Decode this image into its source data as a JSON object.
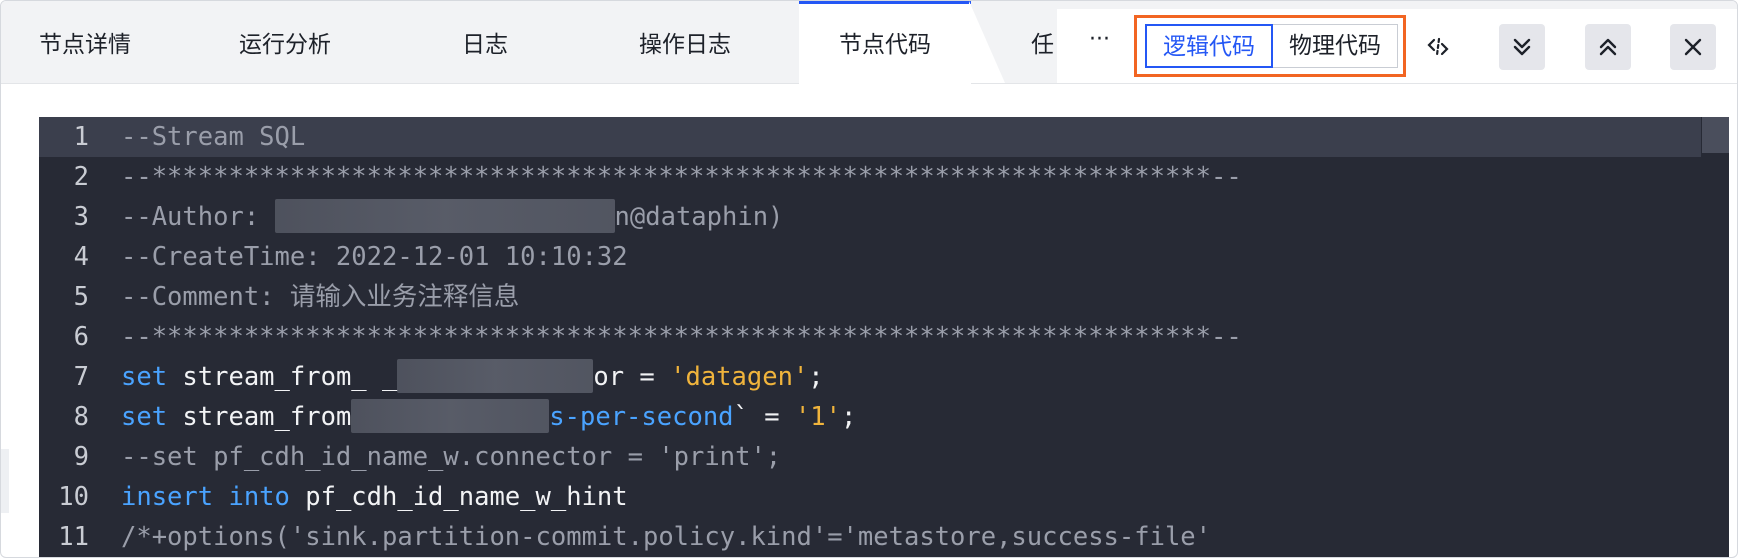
{
  "tabs": [
    {
      "label": "节点详情"
    },
    {
      "label": "运行分析"
    },
    {
      "label": "日志"
    },
    {
      "label": "操作日志"
    },
    {
      "label": "节点代码"
    },
    {
      "label": "任"
    }
  ],
  "toolbar": {
    "more_label": "···",
    "logical_code_label": "逻辑代码",
    "physical_code_label": "物理代码",
    "icons": [
      "format-code-icon",
      "collapse-down-icon",
      "expand-up-icon",
      "close-icon"
    ]
  },
  "colors": {
    "accent": "#2457f5",
    "highlight_outline": "#f26522",
    "editor_bg": "#272a35",
    "keyword": "#4aa3ff",
    "string": "#f0b43c",
    "comment": "#9a9eaa"
  },
  "editor": {
    "line_numbers": [
      "1",
      "2",
      "3",
      "4",
      "5",
      "6",
      "7",
      "8",
      "9",
      "10",
      "11"
    ],
    "current_line": "1",
    "lines": {
      "l1": "--Stream SQL",
      "l2": "--*********************************************************************--",
      "l3_prefix": "--Author: ",
      "l3_suffix": "n@dataphin)",
      "l4": "--CreateTime: 2022-12-01 10:10:32",
      "l5": "--Comment: 请输入业务注释信息",
      "l6": "--*********************************************************************--",
      "l7_kw": "set",
      "l7_ident": " stream_from_ _",
      "l7_rest": "or = ",
      "l7_str": "'datagen'",
      "l7_end": ";",
      "l8_kw": "set",
      "l8_ident": " stream_from",
      "l8_key": "s-per-second",
      "l8_rest": "` = ",
      "l8_str": "'1'",
      "l8_end": ";",
      "l9": "--set pf_cdh_id_name_w.connector = 'print';",
      "l10_kw": "insert into",
      "l10_ident": " pf_cdh_id_name_w_hint",
      "l11": "/*+options('sink.partition-commit.policy.kind'='metastore,success-file'"
    }
  }
}
